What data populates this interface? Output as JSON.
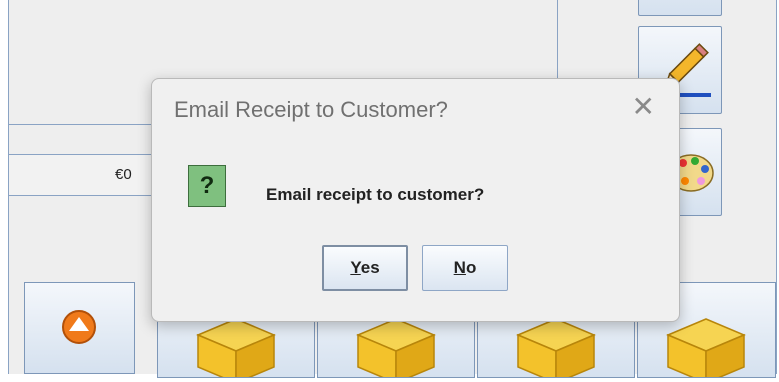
{
  "background": {
    "total_value": "€0"
  },
  "dialog": {
    "title": "Email Receipt to Customer?",
    "message": "Email receipt to customer?",
    "yes_mnemonic": "Y",
    "yes_rest": "es",
    "no_mnemonic": "N",
    "no_rest": "o",
    "close_glyph": "✕",
    "question_glyph": "?"
  },
  "icons": {
    "edit": "pencil-icon",
    "theme": "palette-icon",
    "scroll_up": "arrow-up-circle-icon",
    "category": "open-box-icon"
  },
  "colors": {
    "accent_blue": "#8aa3c4",
    "question_green": "#7fc07f",
    "box_yellow": "#f3c22b",
    "up_orange": "#f07a1a"
  }
}
